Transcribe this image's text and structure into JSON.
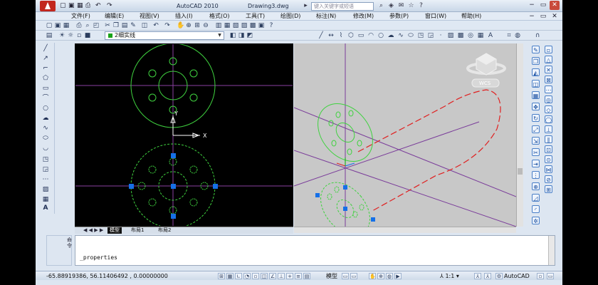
{
  "titlebar": {
    "quick_access": [
      "▢",
      "▣",
      "▦",
      "⎙",
      "↶",
      "↷"
    ],
    "app_title": "AutoCAD 2010",
    "file_title": "Drawing3.dwg",
    "search_placeholder": "键入关键字或短语",
    "window_buttons": [
      "−",
      "▭",
      "✕"
    ]
  },
  "menubar": {
    "items": [
      "文件(F)",
      "编辑(E)",
      "视图(V)",
      "插入(I)",
      "格式(O)",
      "工具(T)",
      "绘图(D)",
      "标注(N)",
      "修改(M)",
      "参数(P)",
      "窗口(W)",
      "帮助(H)"
    ]
  },
  "layer_toolbar": {
    "current_layer": "2细实线"
  },
  "layout_tabs": {
    "nav": "◀ ◀ ▶ ▶",
    "tabs": [
      "模型",
      "布局1",
      "布局2"
    ]
  },
  "command": {
    "side_label": "命令",
    "text": "_properties"
  },
  "statusbar": {
    "coordinates": "-65.88919386, 56.11406492 , 0.00000000",
    "model_label": "模型",
    "scale": "1:1",
    "workspace": "AutoCAD"
  },
  "viewcube": {
    "wcs_label": "WCS"
  },
  "colors": {
    "green_dashed": "#3fd23f",
    "red_path": "#e02020",
    "grip_blue": "#1570e8",
    "crosshair_purple": "#8a3fa0"
  }
}
